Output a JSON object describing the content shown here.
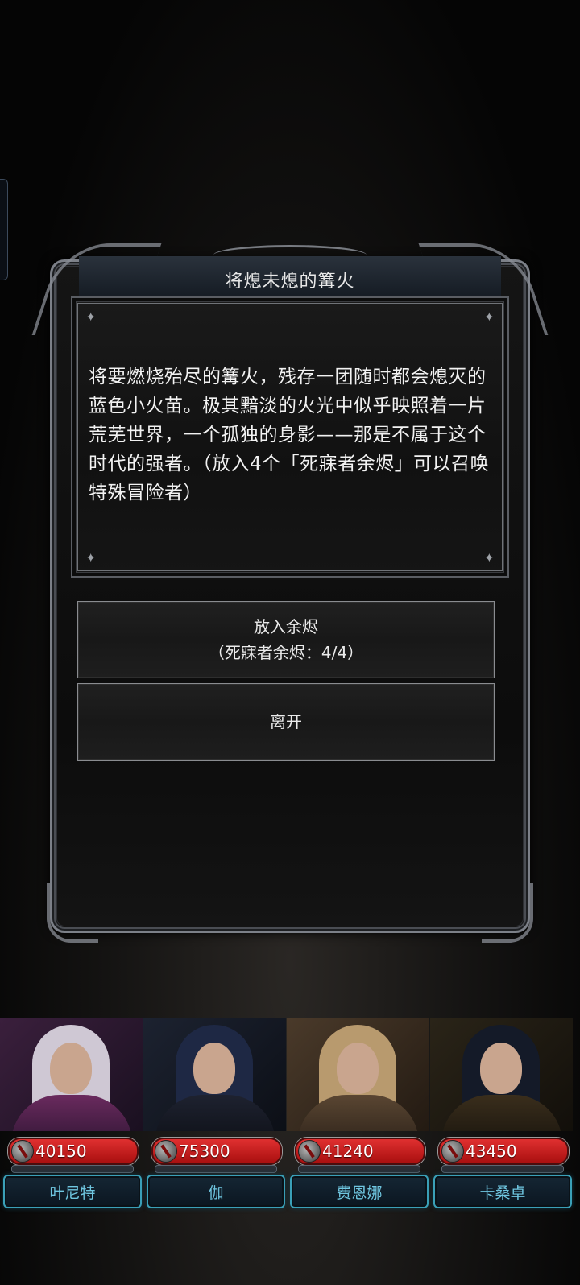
{
  "dialog": {
    "title": "将熄未熄的篝火",
    "description": "将要燃烧殆尽的篝火，残存一团随时都会熄灭的蓝色小火苗。极其黯淡的火光中似乎映照着一片荒芜世界，一个孤独的身影——那是不属于这个时代的强者。（放入4个「死寐者余烬」可以召唤特殊冒险者）",
    "options": [
      {
        "label": "放入余烬",
        "detail": "（死寐者余烬：4/4）"
      },
      {
        "label": "离开"
      }
    ]
  },
  "party": [
    {
      "name": "叶尼特",
      "hp": "40150"
    },
    {
      "name": "伽",
      "hp": "75300"
    },
    {
      "name": "费恩娜",
      "hp": "41240"
    },
    {
      "name": "卡桑卓",
      "hp": "43450"
    }
  ],
  "colors": {
    "hp_bar": "#c81c1c",
    "name_plate_border": "#3aa0b8",
    "name_text": "#6fc6e0",
    "frame": "#7c8088"
  }
}
